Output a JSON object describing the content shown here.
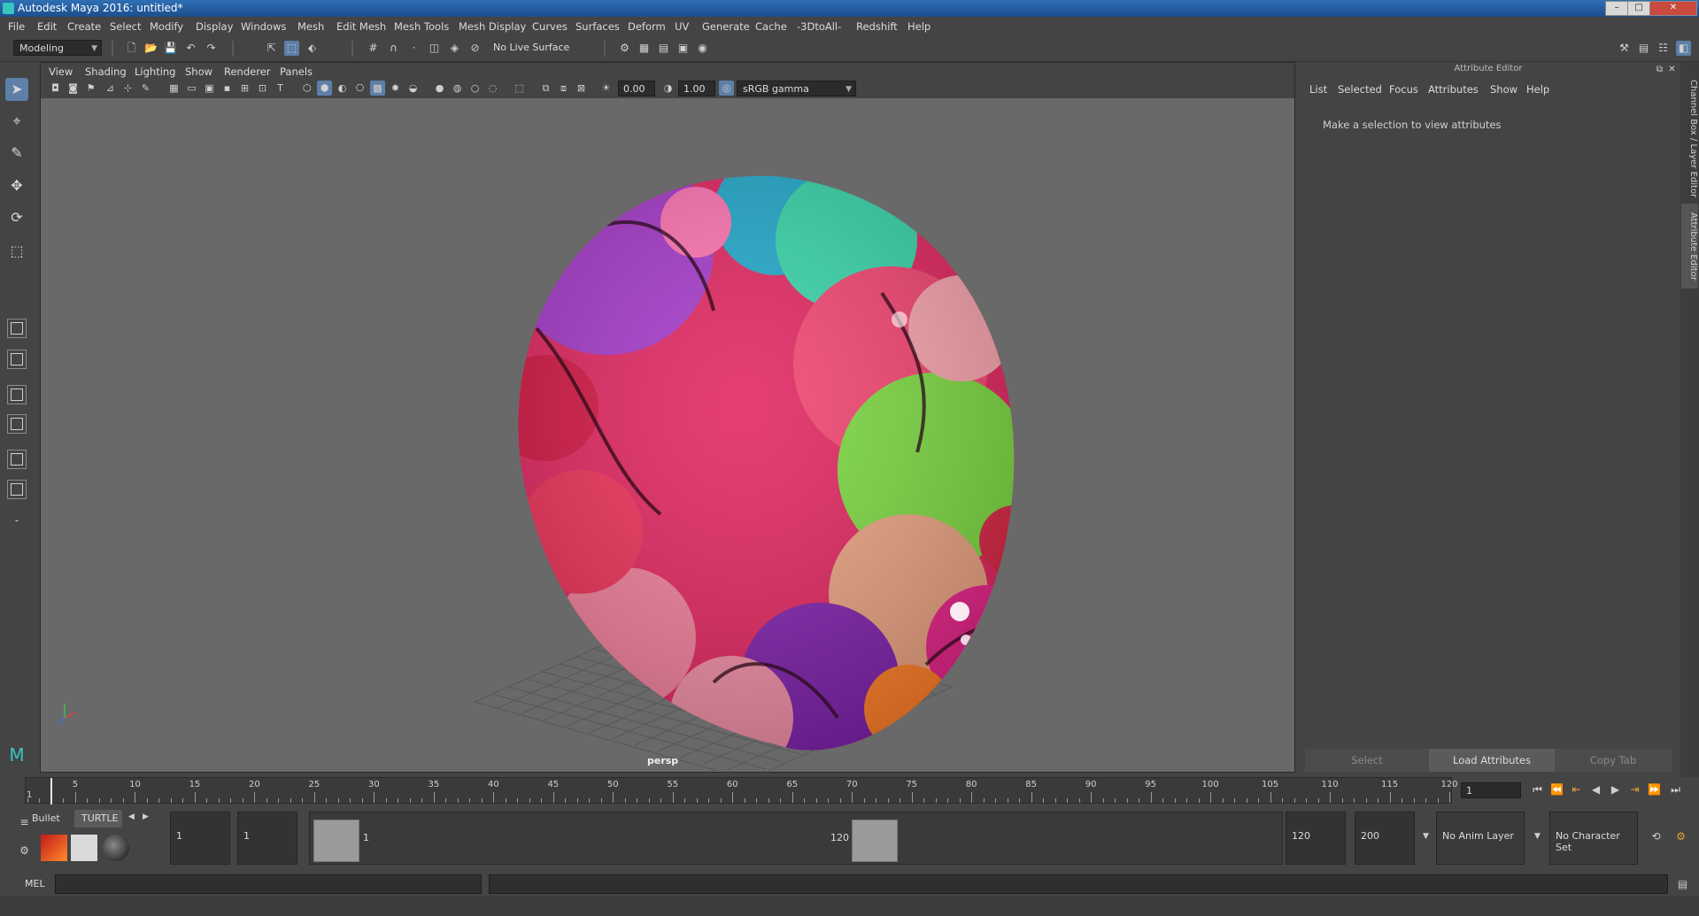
{
  "window": {
    "title": "Autodesk Maya 2016: untitled*"
  },
  "menubar": [
    "File",
    "Edit",
    "Create",
    "Select",
    "Modify",
    "Display",
    "Windows",
    "Mesh",
    "Edit Mesh",
    "Mesh Tools",
    "Mesh Display",
    "Curves",
    "Surfaces",
    "Deform",
    "UV",
    "Generate",
    "Cache",
    "-3DtoAll-",
    "Redshift",
    "Help"
  ],
  "statusline": {
    "mode": "Modeling",
    "live_surface": "No Live Surface"
  },
  "panel": {
    "menus": [
      "View",
      "Shading",
      "Lighting",
      "Show",
      "Renderer",
      "Panels"
    ],
    "exposure": "0.00",
    "gamma": "1.00",
    "color_space": "sRGB gamma",
    "camera": "persp"
  },
  "attribute_editor": {
    "header": "Attribute Editor",
    "menus": [
      "List",
      "Selected",
      "Focus",
      "Attributes",
      "Show",
      "Help"
    ],
    "message": "Make a selection to view attributes",
    "buttons": {
      "select": "Select",
      "load": "Load Attributes",
      "copy": "Copy Tab"
    }
  },
  "side_tabs": {
    "channel_box": "Channel Box / Layer Editor",
    "attr_editor": "Attribute Editor"
  },
  "timeline": {
    "ticks": [
      "5",
      "10",
      "15",
      "20",
      "25",
      "30",
      "35",
      "40",
      "45",
      "50",
      "55",
      "60",
      "65",
      "70",
      "75",
      "80",
      "85",
      "90",
      "95",
      "100",
      "105",
      "110",
      "115",
      "120"
    ],
    "current_frame_label": "1",
    "current_frame_field": "1"
  },
  "range": {
    "start": "1",
    "anim_start": "1",
    "slider_start": "1",
    "slider_end": "120",
    "end": "120",
    "anim_end": "200",
    "anim_layer": "No Anim Layer",
    "character_set": "No Character Set"
  },
  "shelf": {
    "tab_bullet": "Bullet",
    "tab_turtle": "TURTLE"
  },
  "command_line": {
    "label": "MEL"
  },
  "colors": {
    "accent": "#5d7fa8",
    "viewport_bg": "#696969",
    "title_bar": "#1c4f8e"
  }
}
